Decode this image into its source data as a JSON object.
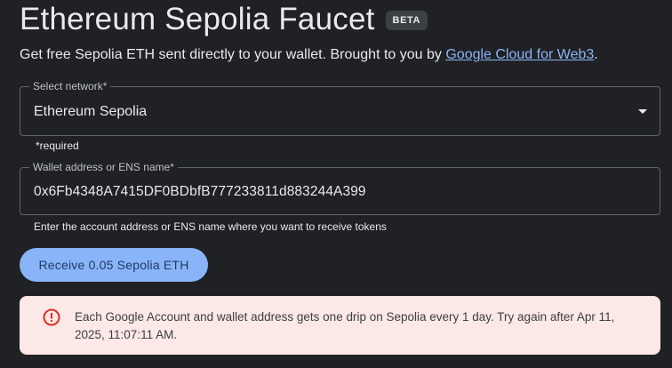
{
  "header": {
    "title": "Ethereum Sepolia Faucet",
    "badge": "BETA",
    "subtitle_prefix": "Get free Sepolia ETH sent directly to your wallet. Brought to you by ",
    "subtitle_link": "Google Cloud for Web3",
    "subtitle_suffix": "."
  },
  "network_select": {
    "label": "Select network*",
    "value": "Ethereum Sepolia",
    "required_note": "*required"
  },
  "wallet_input": {
    "label": "Wallet address or ENS name*",
    "value": "0x6Fb4348A7415DF0BDbfB777233811d883244A399",
    "helper": "Enter the account address or ENS name where you want to receive tokens"
  },
  "receive_button": {
    "label": "Receive 0.05 Sepolia ETH"
  },
  "alert": {
    "icon": "error-icon",
    "message": "Each Google Account and wallet address gets one drip on Sepolia every 1 day. Try again after Apr 11, 2025, 11:07:11 AM."
  },
  "colors": {
    "background": "#202124",
    "accent": "#8ab4f8",
    "alert_background": "#fce8e6",
    "error": "#d93025"
  }
}
